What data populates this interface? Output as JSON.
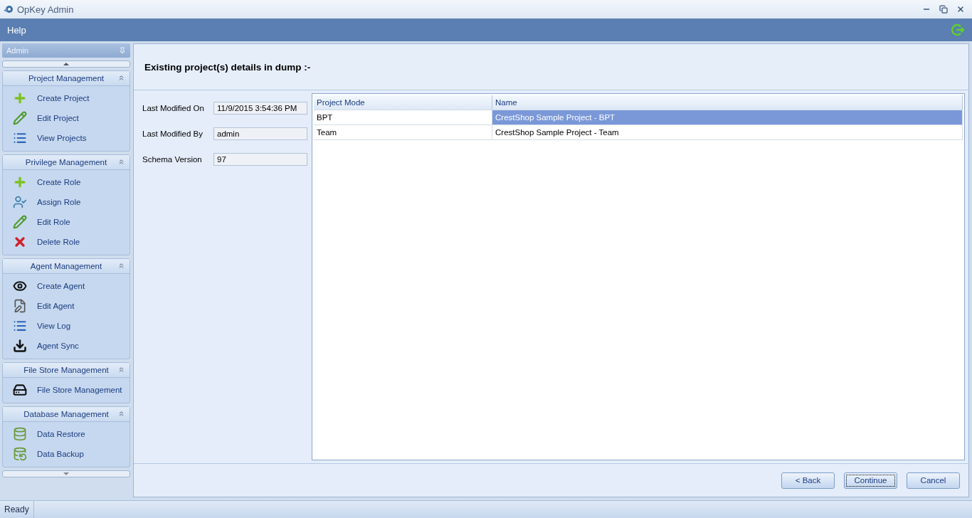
{
  "window": {
    "title": "OpKey Admin"
  },
  "menu_bar": {
    "items": [
      "Help"
    ]
  },
  "sidebar": {
    "title": "Admin",
    "sections": [
      {
        "title": "Project Management",
        "expanded": true,
        "items": [
          {
            "label": "Create Project",
            "kind": "create"
          },
          {
            "label": "Edit Project",
            "kind": "edit"
          },
          {
            "label": "View Projects",
            "kind": "list"
          }
        ]
      },
      {
        "title": "Privilege Management",
        "expanded": true,
        "items": [
          {
            "label": "Create Role",
            "kind": "create"
          },
          {
            "label": "Assign Role",
            "kind": "assign"
          },
          {
            "label": "Edit Role",
            "kind": "edit"
          },
          {
            "label": "Delete Role",
            "kind": "delete"
          }
        ]
      },
      {
        "title": "Agent Management",
        "expanded": true,
        "items": [
          {
            "label": "Create Agent",
            "kind": "agent"
          },
          {
            "label": "Edit Agent",
            "kind": "editfile"
          },
          {
            "label": "View Log",
            "kind": "list"
          },
          {
            "label": "Agent Sync",
            "kind": "sync"
          }
        ]
      },
      {
        "title": "File Store Management",
        "expanded": true,
        "items": [
          {
            "label": "File Store Management",
            "kind": "disk"
          }
        ]
      },
      {
        "title": "Database Management",
        "expanded": true,
        "items": [
          {
            "label": "Data Restore",
            "kind": "restore"
          },
          {
            "label": "Data Backup",
            "kind": "backup"
          }
        ]
      }
    ]
  },
  "main": {
    "heading": "Existing project(s) details in dump :-",
    "fields": [
      {
        "label": "Last Modified On",
        "value": "11/9/2015 3:54:36 PM"
      },
      {
        "label": "Last Modified By",
        "value": "admin"
      },
      {
        "label": "Schema Version",
        "value": "97"
      }
    ],
    "table": {
      "columns": [
        "Project Mode",
        "Name"
      ],
      "rows": [
        {
          "cells": [
            "BPT",
            "CrestShop Sample Project - BPT"
          ],
          "selected": true
        },
        {
          "cells": [
            "Team",
            "CrestShop Sample Project - Team"
          ],
          "selected": false
        }
      ]
    },
    "buttons": [
      {
        "label": "< Back",
        "focused": false
      },
      {
        "label": "Continue",
        "focused": true
      },
      {
        "label": "Cancel",
        "focused": false
      }
    ]
  },
  "status_bar": {
    "text": "Ready"
  }
}
